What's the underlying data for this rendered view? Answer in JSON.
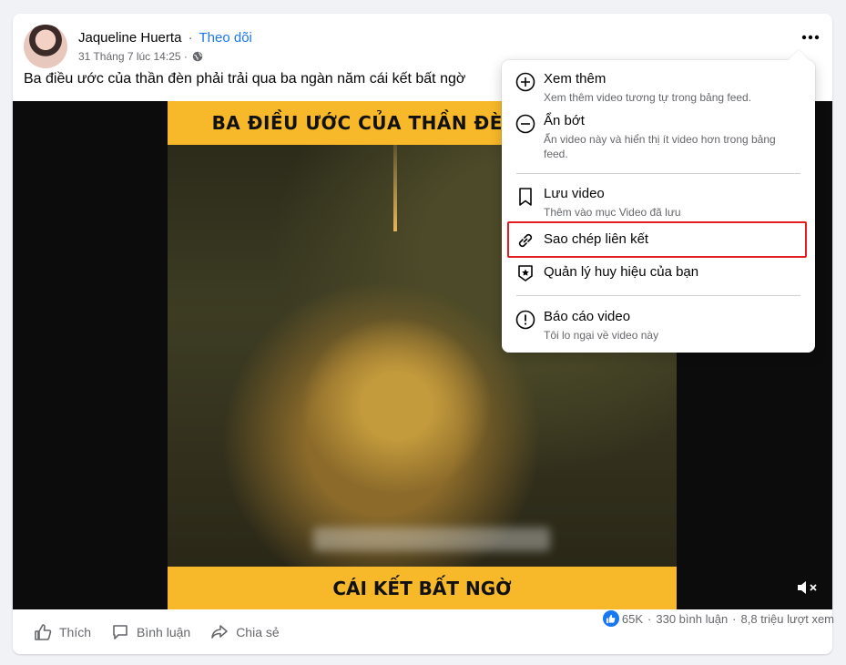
{
  "post": {
    "author": "Jaqueline Huerta",
    "separator": "·",
    "follow": "Theo dõi",
    "timestamp": "31 Tháng 7 lúc 14:25 ·",
    "caption": "Ba điều ước của thần đèn phải trải qua ba ngàn năm cái kết bất ngờ"
  },
  "video": {
    "top_banner": "BA ĐIỀU ƯỚC CỦA THẦN ĐÈN PHẢI TRẢI",
    "bottom_banner": "CÁI KẾT BẤT NGỜ"
  },
  "actions": {
    "like": "Thích",
    "comment": "Bình luận",
    "share": "Chia sẻ"
  },
  "stats": {
    "reactions": "65K",
    "comments": "330 bình luận",
    "views": "8,8 triệu lượt xem",
    "separator": "·"
  },
  "menu": {
    "items": [
      {
        "label": "Xem thêm",
        "sub": "Xem thêm video tương tự trong bảng feed.",
        "icon": "plus-circle-icon"
      },
      {
        "label": "Ẩn bớt",
        "sub": "Ẩn video này và hiển thị ít video hơn trong bảng feed.",
        "icon": "minus-circle-icon"
      },
      {
        "label": "Lưu video",
        "sub": "Thêm vào mục Video đã lưu",
        "icon": "bookmark-icon"
      },
      {
        "label": "Sao chép liên kết",
        "sub": "",
        "icon": "link-icon"
      },
      {
        "label": "Quản lý huy hiệu của bạn",
        "sub": "",
        "icon": "badge-icon"
      },
      {
        "label": "Báo cáo video",
        "sub": "Tôi lo ngại về video này",
        "icon": "alert-circle-icon"
      }
    ]
  },
  "colors": {
    "accent": "#1877f2",
    "highlight": "#e41e20",
    "banner": "#f7b92a"
  }
}
